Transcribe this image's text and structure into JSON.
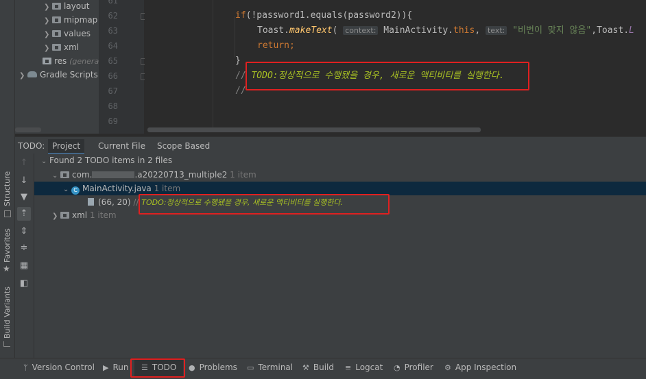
{
  "left_strip": {
    "tabs": [
      "Structure",
      "Favorites",
      "Build Variants"
    ]
  },
  "project_tree": {
    "items": [
      {
        "label": "layout",
        "type": "folder"
      },
      {
        "label": "mipmap",
        "type": "folder"
      },
      {
        "label": "values",
        "type": "folder"
      },
      {
        "label": "xml",
        "type": "folder"
      },
      {
        "label": "res",
        "suffix": "(generat",
        "type": "res-folder"
      },
      {
        "label": "Gradle Scripts",
        "type": "gradle"
      }
    ]
  },
  "editor": {
    "line_numbers": [
      "61",
      "62",
      "63",
      "64",
      "65",
      "66",
      "67",
      "68",
      "69"
    ],
    "lines": {
      "l62_kw": "if",
      "l62_rest": "(!password1.equals(password2)){",
      "l63_toast": "Toast.",
      "l63_method": "makeText",
      "l63_paren": "( ",
      "l63_hint1": "context:",
      "l63_main": " MainActivity.",
      "l63_this": "this",
      "l63_comma": ", ",
      "l63_hint2": "text:",
      "l63_str": " \"비번이 맞지 않음\"",
      "l63_tail": ",Toast.",
      "l63_tail2": "L",
      "l64_return": "return",
      "l64_semi": ";",
      "l65_brace": "}",
      "l66_slashes": "// ",
      "l66_todo": "TODO:정상적으로 수행됐을 경우, 새로운 액티비티를 실행한다.",
      "l67_slashes": "//"
    }
  },
  "todo_panel": {
    "title": "TODO:",
    "tabs": [
      "Project",
      "Current File",
      "Scope Based"
    ],
    "selected_tab": "Project",
    "summary": "Found 2 TODO items in 2 files",
    "package": {
      "name_prefix": "com.",
      "name_suffix": ".a20220713_multiple2",
      "count": "1 item"
    },
    "file": {
      "name": "MainActivity.java",
      "count": "1 item",
      "class_icon": "C"
    },
    "entry": {
      "position": "(66, 20)",
      "slashes": "//",
      "text": "TODO:정상적으로 수행됐을 경우, 새로운 액티비티를 실행한다."
    },
    "xml": {
      "name": "xml",
      "count": "1 item"
    }
  },
  "bottom_bar": {
    "items": [
      {
        "label": "Version Control",
        "icon": "branch-icon"
      },
      {
        "label": "Run",
        "icon": "run-icon"
      },
      {
        "label": "TODO",
        "icon": "list-icon"
      },
      {
        "label": "Problems",
        "icon": "problems-icon"
      },
      {
        "label": "Terminal",
        "icon": "terminal-icon"
      },
      {
        "label": "Build",
        "icon": "hammer-icon"
      },
      {
        "label": "Logcat",
        "icon": "logcat-icon"
      },
      {
        "label": "Profiler",
        "icon": "profiler-icon"
      },
      {
        "label": "App Inspection",
        "icon": "inspection-icon"
      }
    ],
    "selected": "TODO"
  },
  "colors": {
    "highlight_box": "#e02020",
    "todo_text": "#a8c023",
    "keyword": "#cc7832",
    "selection": "#0d293e"
  }
}
